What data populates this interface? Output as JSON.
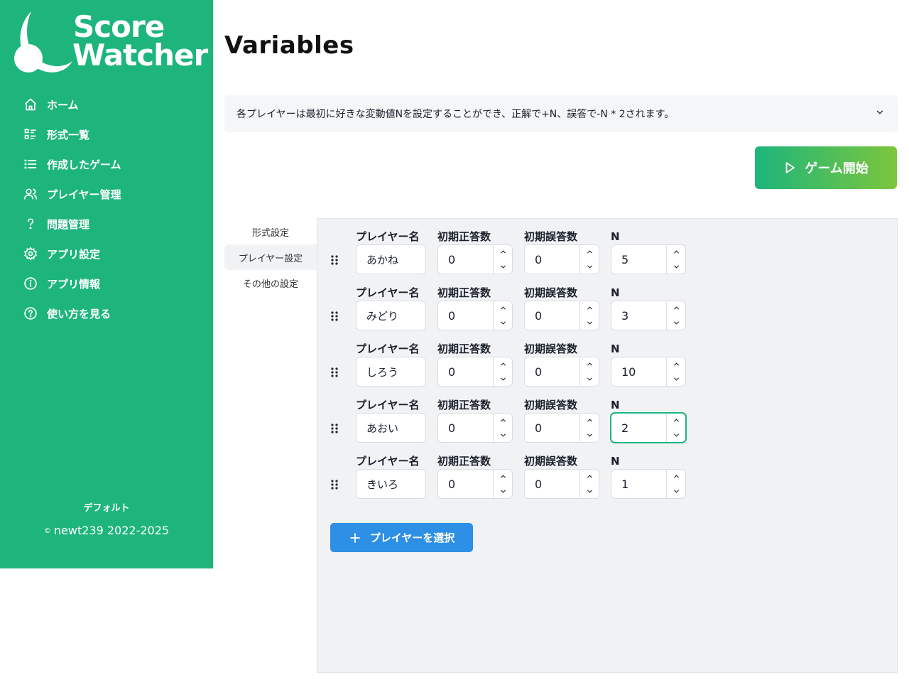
{
  "brand": {
    "line1": "Score",
    "line2": "Watcher",
    "color": "#1db57c"
  },
  "sidebar": {
    "items": [
      {
        "label": "ホーム",
        "icon": "home-icon"
      },
      {
        "label": "形式一覧",
        "icon": "list-icon"
      },
      {
        "label": "作成したゲーム",
        "icon": "menu-list-icon"
      },
      {
        "label": "プレイヤー管理",
        "icon": "users-icon"
      },
      {
        "label": "問題管理",
        "icon": "question-icon"
      },
      {
        "label": "アプリ設定",
        "icon": "gear-icon"
      },
      {
        "label": "アプリ情報",
        "icon": "info-icon"
      },
      {
        "label": "使い方を見る",
        "icon": "help-circle-icon"
      }
    ],
    "profile": "デフォルト",
    "copyright_symbol": "©",
    "copyright": "newt239  2022-2025"
  },
  "page": {
    "title": "Variables",
    "description": "各プレイヤーは最初に好きな変動値Nを設定することができ、正解で+N、誤答で-N * 2されます。",
    "start_button": "ゲーム開始"
  },
  "tabs": [
    {
      "label": "形式設定",
      "active": false
    },
    {
      "label": "プレイヤー設定",
      "active": true
    },
    {
      "label": "その他の設定",
      "active": false
    }
  ],
  "columns": {
    "name": "プレイヤー名",
    "correct": "初期正答数",
    "wrong": "初期誤答数",
    "n": "N"
  },
  "players": [
    {
      "name": "あかね",
      "correct": "0",
      "wrong": "0",
      "n": "5"
    },
    {
      "name": "みどり",
      "correct": "0",
      "wrong": "0",
      "n": "3"
    },
    {
      "name": "しろう",
      "correct": "0",
      "wrong": "0",
      "n": "10"
    },
    {
      "name": "あおい",
      "correct": "0",
      "wrong": "0",
      "n": "2"
    },
    {
      "name": "きいろ",
      "correct": "0",
      "wrong": "0",
      "n": "1"
    }
  ],
  "add_player_button": "プレイヤーを選択",
  "colors": {
    "accent": "#1db57c",
    "gradient_end": "#7cc63c",
    "primary_button": "#2d8fe6",
    "panel_bg": "#f1f2f4"
  }
}
